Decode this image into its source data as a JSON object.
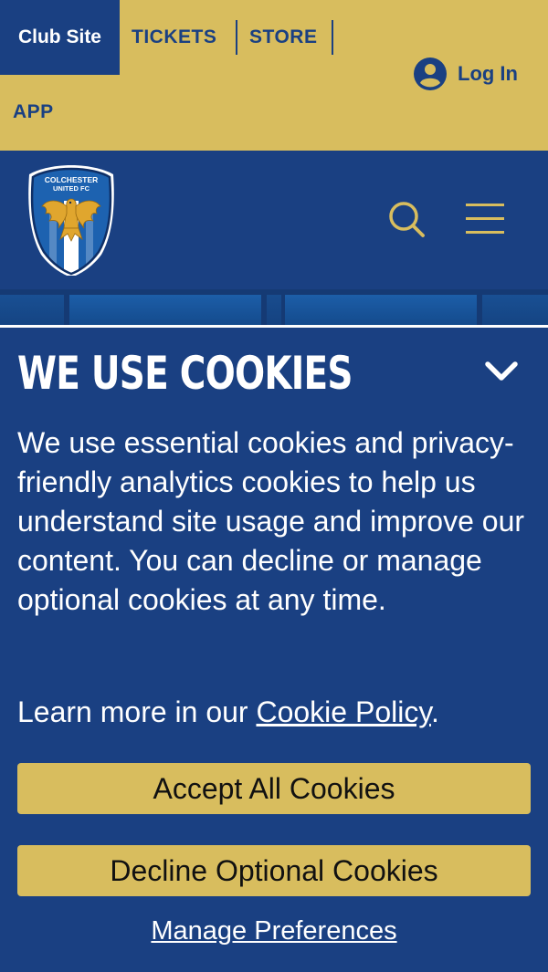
{
  "topbar": {
    "club_site": "Club Site",
    "tickets": "TICKETS",
    "store": "STORE",
    "app": "APP",
    "login": "Log In"
  },
  "header": {
    "crest_text_line1": "COLCHESTER",
    "crest_text_line2": "UNITED FC",
    "icons": [
      "crest-logo",
      "search-icon",
      "hamburger-menu-icon"
    ]
  },
  "cookie_banner": {
    "title": "WE USE COOKIES",
    "body": "We use essential cookies and privacy-friendly analytics cookies to help us understand site usage and improve our content. You can decline or manage optional cookies at any time.",
    "learn_more_prefix": "Learn more in our ",
    "policy_link": "Cookie Policy",
    "learn_more_suffix": ".",
    "accept_label": "Accept All Cookies",
    "decline_label": "Decline Optional Cookies",
    "manage_label": "Manage Preferences",
    "collapse_icon": "chevron-down-icon"
  },
  "colors": {
    "navy": "#1a4082",
    "gold": "#d8bd5e",
    "text_light": "#ffffff",
    "button_text": "#111111"
  }
}
